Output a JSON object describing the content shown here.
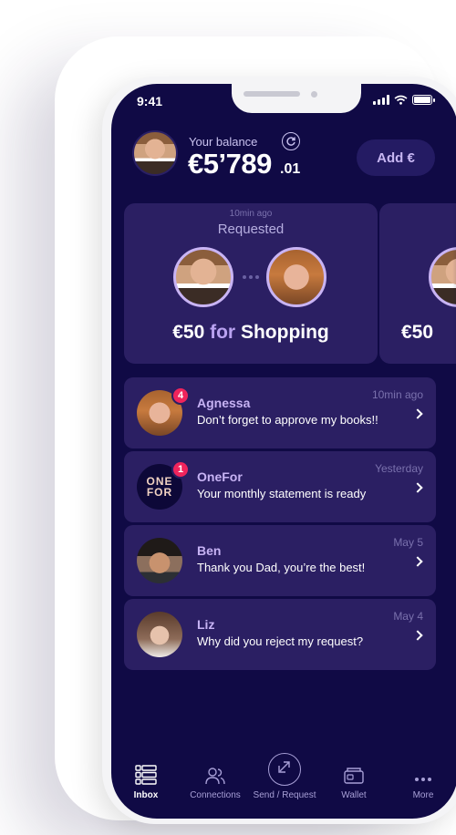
{
  "status_bar": {
    "time": "9:41"
  },
  "header": {
    "balance_label": "Your balance",
    "balance_amount": "€5’789",
    "balance_cents": ".01",
    "add_button_label": "Add €"
  },
  "request_cards": [
    {
      "time": "10min ago",
      "status": "Requested",
      "amount": "€50",
      "for_word": "for",
      "purpose": "Shopping"
    },
    {
      "amount": "€50"
    }
  ],
  "messages": [
    {
      "name": "Agnessa",
      "text": "Don’t forget to approve my books!!",
      "time": "10min ago",
      "badge": "4",
      "avatar": "woman"
    },
    {
      "name": "OneFor",
      "text": "Your monthly statement is ready",
      "time": "Yesterday",
      "badge": "1",
      "avatar": "onefor-logo",
      "logo_line1": "ONE",
      "logo_line2": "FOR"
    },
    {
      "name": "Ben",
      "text": "Thank you Dad, you’re the best!",
      "time": "May 5",
      "avatar": "man"
    },
    {
      "name": "Liz",
      "text": "Why did you reject my request?",
      "time": "May 4",
      "avatar": "woman"
    }
  ],
  "tabs": [
    {
      "label": "Inbox",
      "icon": "inbox-icon",
      "active": true
    },
    {
      "label": "Connections",
      "icon": "connections-icon"
    },
    {
      "label": "Send / Request",
      "icon": "send-request-icon"
    },
    {
      "label": "Wallet",
      "icon": "wallet-icon"
    },
    {
      "label": "More",
      "icon": "more-icon"
    }
  ],
  "colors": {
    "screen_background": "#100a45",
    "card_background": "#2b1f63",
    "accent": "#b9a2f0",
    "badge": "#f0245c"
  }
}
